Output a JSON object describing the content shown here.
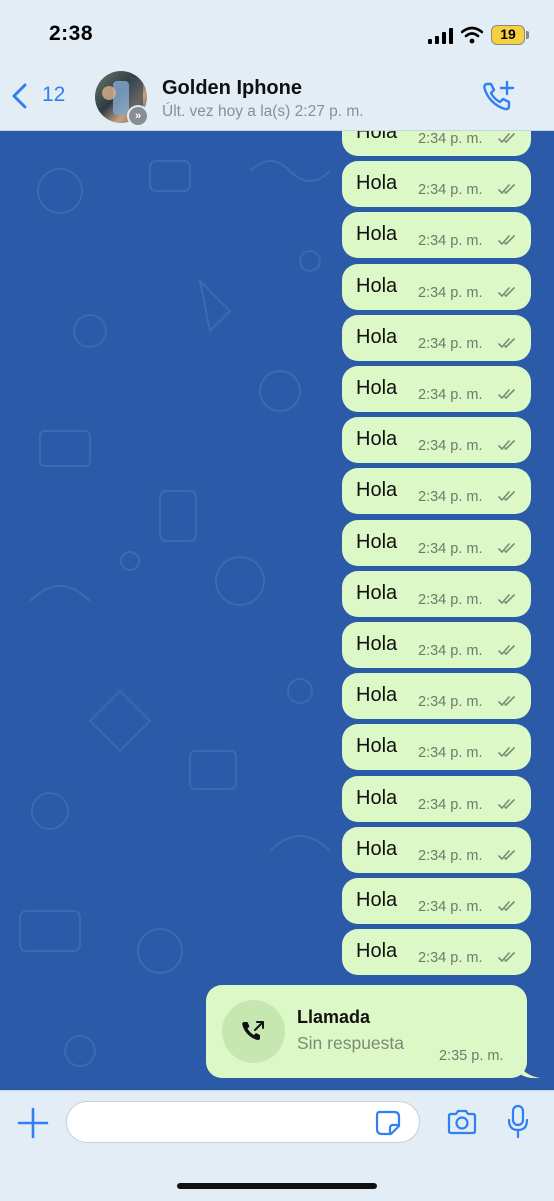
{
  "status_bar": {
    "time": "2:38",
    "battery": "19"
  },
  "header": {
    "back_count": "12",
    "contact_name": "Golden Iphone",
    "last_seen": "Últ. vez hoy a la(s) 2:27 p. m."
  },
  "messages": [
    {
      "text": "Hola",
      "time": "2:34 p. m.",
      "status": "read"
    },
    {
      "text": "Hola",
      "time": "2:34 p. m.",
      "status": "read"
    },
    {
      "text": "Hola",
      "time": "2:34 p. m.",
      "status": "read"
    },
    {
      "text": "Hola",
      "time": "2:34 p. m.",
      "status": "read"
    },
    {
      "text": "Hola",
      "time": "2:34 p. m.",
      "status": "read"
    },
    {
      "text": "Hola",
      "time": "2:34 p. m.",
      "status": "read"
    },
    {
      "text": "Hola",
      "time": "2:34 p. m.",
      "status": "read"
    },
    {
      "text": "Hola",
      "time": "2:34 p. m.",
      "status": "read"
    },
    {
      "text": "Hola",
      "time": "2:34 p. m.",
      "status": "read"
    },
    {
      "text": "Hola",
      "time": "2:34 p. m.",
      "status": "read"
    },
    {
      "text": "Hola",
      "time": "2:34 p. m.",
      "status": "read"
    },
    {
      "text": "Hola",
      "time": "2:34 p. m.",
      "status": "read"
    },
    {
      "text": "Hola",
      "time": "2:34 p. m.",
      "status": "read"
    },
    {
      "text": "Hola",
      "time": "2:34 p. m.",
      "status": "read"
    },
    {
      "text": "Hola",
      "time": "2:34 p. m.",
      "status": "read"
    },
    {
      "text": "Hola",
      "time": "2:34 p. m.",
      "status": "read"
    },
    {
      "text": "Hola",
      "time": "2:34 p. m.",
      "status": "read"
    }
  ],
  "call": {
    "title": "Llamada",
    "subtitle": "Sin respuesta",
    "time": "2:35 p. m."
  },
  "composer": {
    "value": "",
    "placeholder": ""
  },
  "colors": {
    "chat_background": "#2a5aa8",
    "outgoing_bubble": "#dcf8c6",
    "accent": "#2f7ff5",
    "bar_background": "#e3edf6",
    "battery": "#f5d142"
  },
  "icons": [
    "signal-icon",
    "wifi-icon",
    "battery-icon",
    "back-chevron-icon",
    "add-call-icon",
    "phone-outgoing-icon",
    "plus-icon",
    "sticker-icon",
    "camera-icon",
    "mic-icon",
    "double-check-icon"
  ]
}
